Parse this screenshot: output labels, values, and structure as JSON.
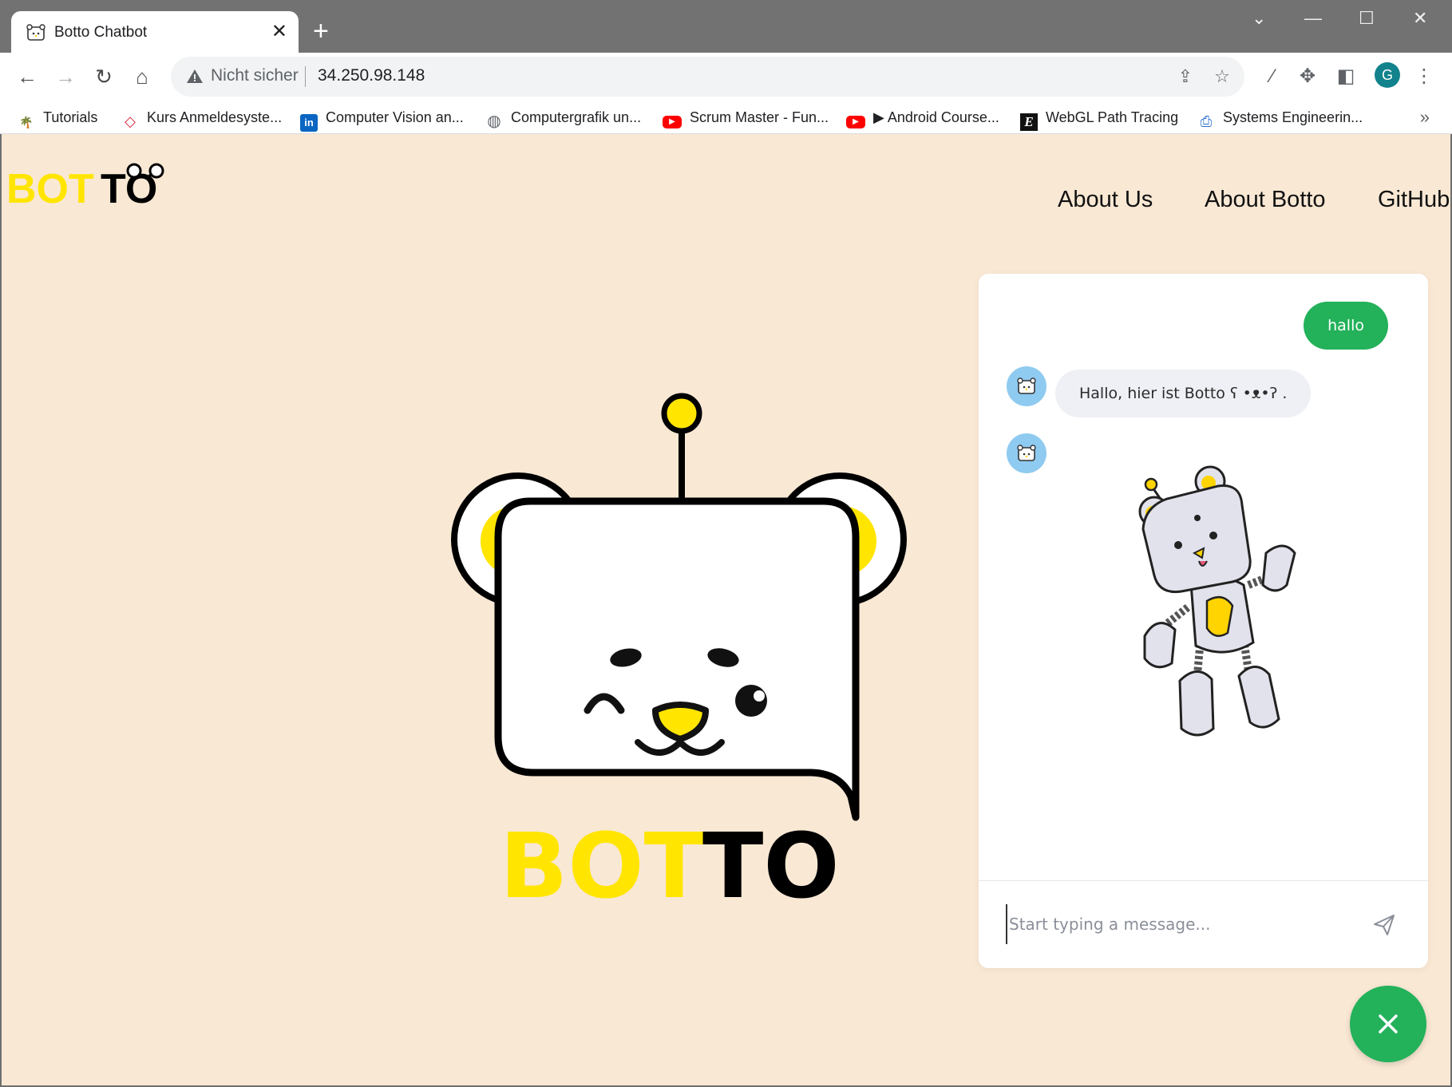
{
  "browser": {
    "tab_title": "Botto Chatbot",
    "tab_close": "✕",
    "new_tab": "+",
    "security_label": "Nicht sicher",
    "url": "34.250.98.148",
    "profile_initial": "G",
    "bookmarks_more": "»",
    "bookmarks": [
      {
        "label": "Tutorials",
        "icon": "palm-tree-icon"
      },
      {
        "label": "Kurs Anmeldesyste...",
        "icon": "red-diamond-icon"
      },
      {
        "label": "Computer Vision an...",
        "icon": "linkedin-icon"
      },
      {
        "label": "Computergrafik un...",
        "icon": "globe-icon"
      },
      {
        "label": "Scrum Master - Fun...",
        "icon": "youtube-icon"
      },
      {
        "label": "▶ Android Course...",
        "icon": "youtube-icon"
      },
      {
        "label": "WebGL Path Tracing",
        "icon": "e-logo-icon"
      },
      {
        "label": "Systems Engineerin...",
        "icon": "document-icon"
      }
    ]
  },
  "site": {
    "logo_bot": "BOT",
    "logo_to": "TO",
    "nav": [
      "About Us",
      "About Botto",
      "GitHub"
    ],
    "hero_bot": "BOT",
    "hero_to": "TO"
  },
  "chat": {
    "messages": [
      {
        "from": "user",
        "text": "hallo"
      },
      {
        "from": "bot",
        "text": "Hallo, hier ist Botto ʕ •ᴥ•ʔ ."
      },
      {
        "from": "bot",
        "type": "image",
        "alt": "Botto robot bear sticker"
      }
    ],
    "input_placeholder": "Start typing a message...",
    "send_icon": "paper-plane-icon",
    "close_icon": "close-icon"
  },
  "colors": {
    "page_bg": "#f9e8d4",
    "accent_green": "#23b15a",
    "brand_yellow": "#ffe500",
    "bot_avatar_bg": "#8fcaf0"
  }
}
